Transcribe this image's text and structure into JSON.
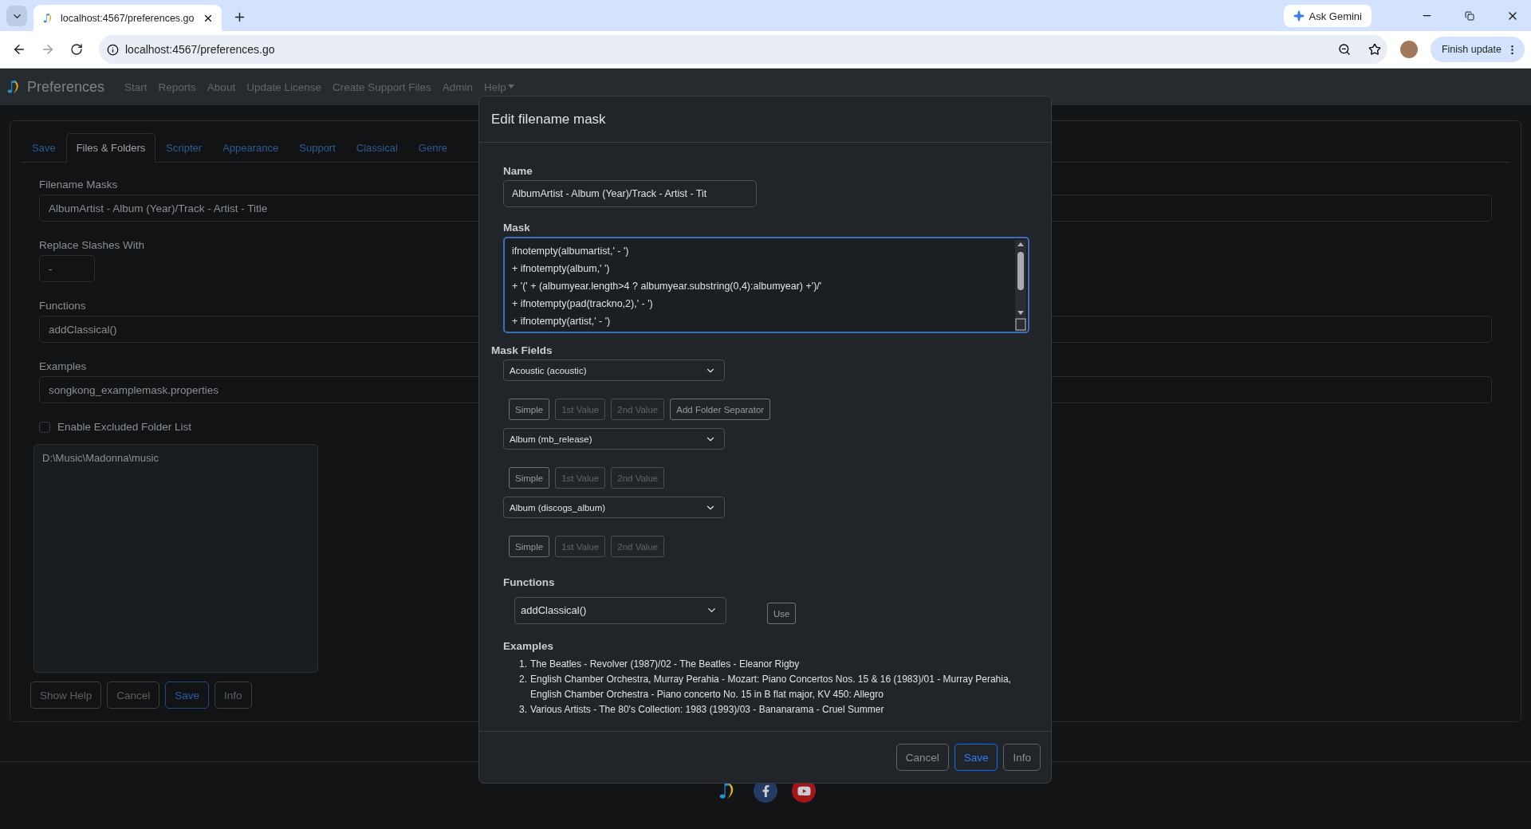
{
  "browser": {
    "tab_title": "localhost:4567/preferences.go",
    "url": "localhost:4567/preferences.go",
    "gemini": "Ask Gemini",
    "update": "Finish update"
  },
  "navbar": {
    "brand": "Preferences",
    "items": [
      {
        "label": "Start",
        "dropdown": false
      },
      {
        "label": "Reports",
        "dropdown": false
      },
      {
        "label": "About",
        "dropdown": false
      },
      {
        "label": "Update License",
        "dropdown": false
      },
      {
        "label": "Create Support Files",
        "dropdown": false
      },
      {
        "label": "Admin",
        "dropdown": false
      },
      {
        "label": "Help",
        "dropdown": true
      }
    ]
  },
  "tabs": [
    {
      "label": "Save",
      "selected": false
    },
    {
      "label": "Files & Folders",
      "selected": true
    },
    {
      "label": "Scripter",
      "selected": false
    },
    {
      "label": "Appearance",
      "selected": false
    },
    {
      "label": "Support",
      "selected": false
    },
    {
      "label": "Classical",
      "selected": false
    },
    {
      "label": "Genre",
      "selected": false
    }
  ],
  "settings": {
    "fields": [
      {
        "label": "Filename Masks",
        "value": "AlbumArtist - Album (Year)/Track - Artist - Title",
        "kind": "wide"
      },
      {
        "label": "Replace Slashes With",
        "value": "-",
        "kind": "short"
      },
      {
        "label": "Functions",
        "value": "addClassical()",
        "kind": "wide"
      },
      {
        "label": "Examples",
        "value": "songkong_examplemask.properties",
        "kind": "wide"
      }
    ],
    "excluded": {
      "label": "Enable Excluded Folder List",
      "checked": false
    },
    "folders": "D:\\Music\\Madonna\\music",
    "buttons": [
      {
        "label": "Show Help",
        "kind": "secondary"
      },
      {
        "label": "Cancel",
        "kind": "secondary"
      },
      {
        "label": "Save",
        "kind": "primary"
      },
      {
        "label": "Info",
        "kind": "secondary"
      }
    ]
  },
  "dialog": {
    "title": "Edit filename mask",
    "name_label": "Name",
    "name_value": "AlbumArtist - Album (Year)/Track - Artist - Tit",
    "mask_label": "Mask",
    "mask_lines": [
      "ifnotempty(albumartist,' - ')",
      "+ ifnotempty(album,' ')",
      "+ '(' + (albumyear.length>4 ? albumyear.substring(0,4):albumyear) +')/'",
      "+ ifnotempty(pad(trackno,2),' - ')",
      "+ ifnotempty(artist,' - ')"
    ],
    "fields_label": "Mask Fields",
    "mask_fields": [
      {
        "value": "Acoustic (acoustic)",
        "buttons": [
          {
            "label": "Simple",
            "disabled": false
          },
          {
            "label": "1st Value",
            "disabled": true
          },
          {
            "label": "2nd Value",
            "disabled": true
          },
          {
            "label": "Add Folder Separator",
            "disabled": false
          }
        ]
      },
      {
        "value": "Album (mb_release)",
        "buttons": [
          {
            "label": "Simple",
            "disabled": false
          },
          {
            "label": "1st Value",
            "disabled": true
          },
          {
            "label": "2nd Value",
            "disabled": true
          }
        ]
      },
      {
        "value": "Album (discogs_album)",
        "buttons": [
          {
            "label": "Simple",
            "disabled": false
          },
          {
            "label": "1st Value",
            "disabled": true
          },
          {
            "label": "2nd Value",
            "disabled": true
          }
        ]
      }
    ],
    "functions_label": "Functions",
    "function_value": "addClassical()",
    "use_button": "Use",
    "examples_label": "Examples",
    "examples": [
      {
        "marker": "1.",
        "text": "The Beatles - Revolver (1987)/02 - The Beatles - Eleanor Rigby"
      },
      {
        "marker": "2.",
        "text": "English Chamber Orchestra, Murray Perahia - Mozart: Piano Concertos Nos. 15 & 16 (1983)/01 - Murray Perahia, English Chamber Orchestra - Piano concerto No. 15 in B flat major, KV 450: Allegro"
      },
      {
        "marker": "3.",
        "text": "Various Artists - The 80's Collection: 1983 (1993)/03 - Bananarama - Cruel Summer"
      }
    ],
    "buttons": [
      {
        "label": "Cancel",
        "kind": "secondary"
      },
      {
        "label": "Save",
        "kind": "primary"
      },
      {
        "label": "Info",
        "kind": "secondary"
      }
    ]
  }
}
